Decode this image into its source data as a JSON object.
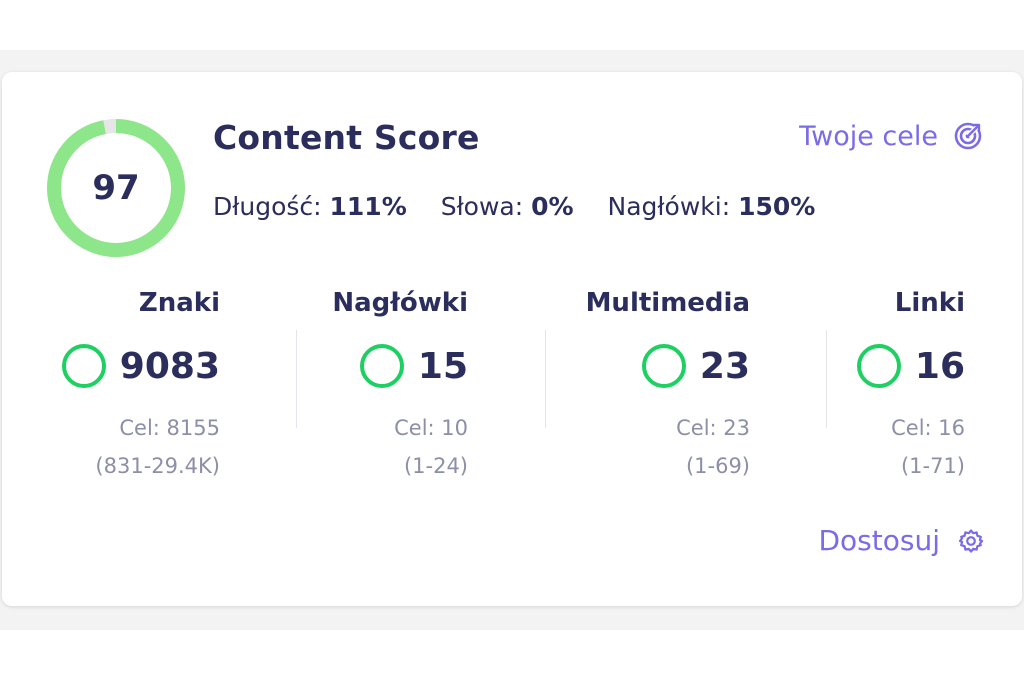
{
  "score": {
    "value": "97",
    "progress": 0.97
  },
  "header": {
    "title": "Content Score",
    "goals_link": "Twoje cele"
  },
  "metrics": [
    {
      "label": "Długość:",
      "value": "111%"
    },
    {
      "label": "Słowa:",
      "value": "0%"
    },
    {
      "label": "Nagłówki:",
      "value": "150%"
    }
  ],
  "stats": [
    {
      "title": "Znaki",
      "value": "9083",
      "target": "Cel: 8155",
      "range": "(831-29.4K)"
    },
    {
      "title": "Nagłówki",
      "value": "15",
      "target": "Cel: 10",
      "range": "(1-24)"
    },
    {
      "title": "Multimedia",
      "value": "23",
      "target": "Cel: 23",
      "range": "(1-69)"
    },
    {
      "title": "Linki",
      "value": "16",
      "target": "Cel: 16",
      "range": "(1-71)"
    }
  ],
  "footer": {
    "customize_label": "Dostosuj"
  },
  "colors": {
    "ring": "#8ee68a",
    "ring_track": "#e6e6e6",
    "status_ok": "#1ed061",
    "link": "#7a6be8",
    "text_dark": "#2b2d5c",
    "text_muted": "#8c8fa8"
  },
  "icons": {
    "goals": "target-icon",
    "customize": "gear-icon",
    "status": "status-circle-icon"
  }
}
